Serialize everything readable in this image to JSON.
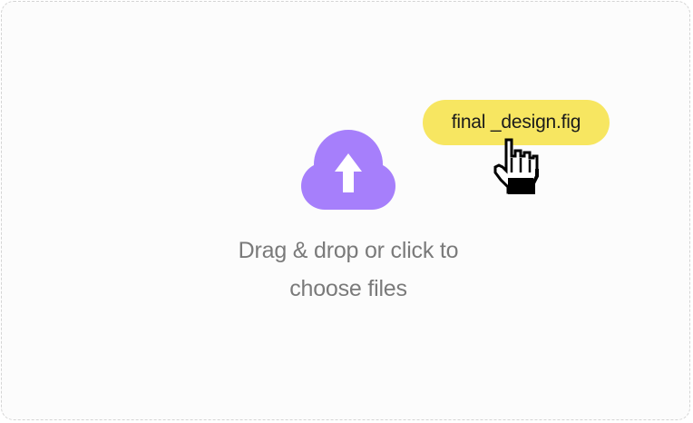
{
  "dropzone": {
    "icon": "cloud-upload-icon",
    "prompt_line1": "Drag & drop or click to",
    "prompt_line2": "choose files"
  },
  "dragged_file": {
    "name": "final _design.fig"
  },
  "cursor": {
    "icon": "hand-pointer-cursor-icon"
  },
  "colors": {
    "accent": "#a67ffb",
    "chip": "#f7e661",
    "prompt_text": "#7a7a7a",
    "border": "#d4d4d4"
  }
}
